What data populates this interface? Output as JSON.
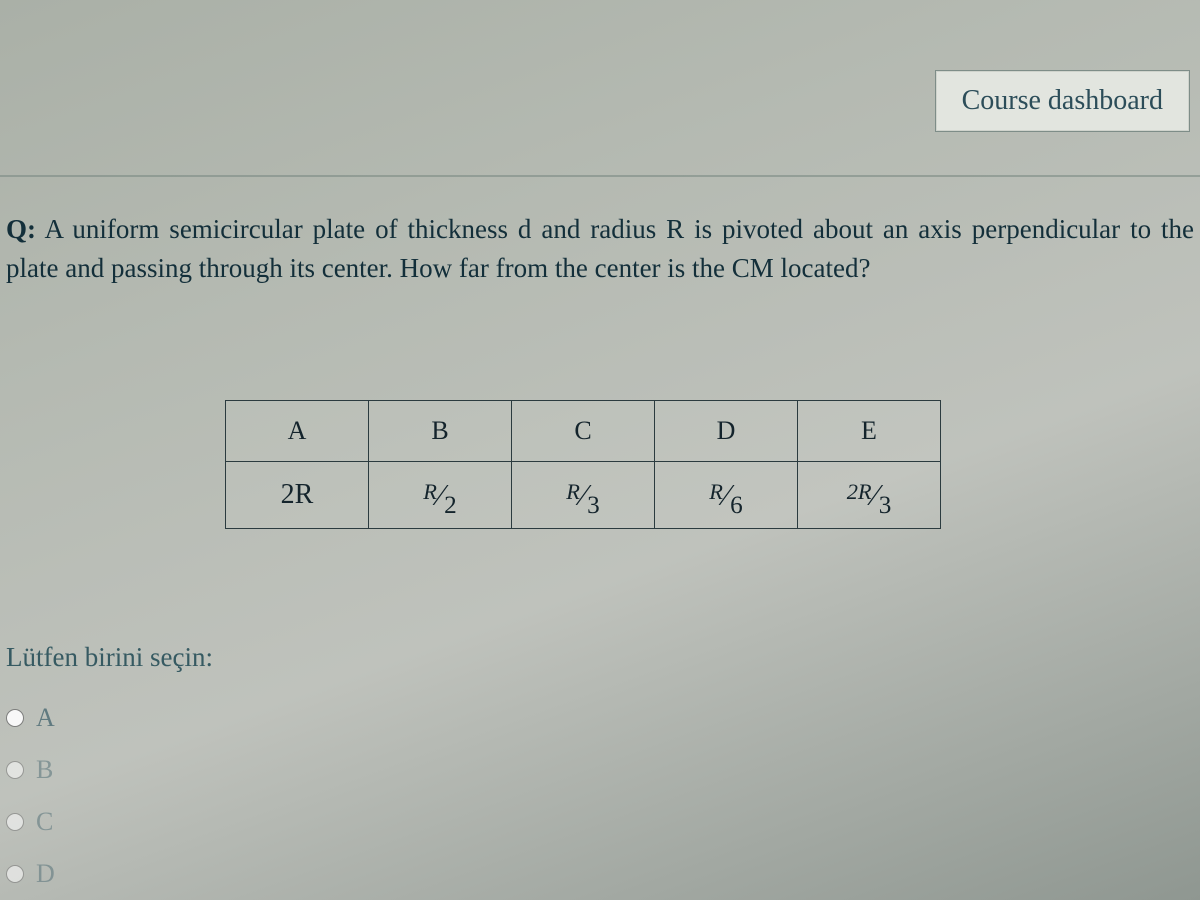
{
  "dashboard_button": "Course dashboard",
  "question": {
    "label": "Q:",
    "text": "A uniform semicircular plate of thickness d and radius R is pivoted about an axis perpendicular to the plate and passing through its center. How far from the center is the CM located?"
  },
  "table": {
    "headers": [
      "A",
      "B",
      "C",
      "D",
      "E"
    ],
    "values_plain": [
      "2R",
      "R/2",
      "R/3",
      "R/6",
      "2R/3"
    ],
    "values": [
      {
        "type": "plain",
        "text": "2R"
      },
      {
        "type": "frac",
        "num": "R",
        "den": "2"
      },
      {
        "type": "frac",
        "num": "R",
        "den": "3"
      },
      {
        "type": "frac",
        "num": "R",
        "den": "6"
      },
      {
        "type": "frac",
        "num": "2R",
        "den": "3"
      }
    ]
  },
  "options": {
    "prompt": "Lütfen birini seçin:",
    "items": [
      "A",
      "B",
      "C",
      "D"
    ]
  }
}
